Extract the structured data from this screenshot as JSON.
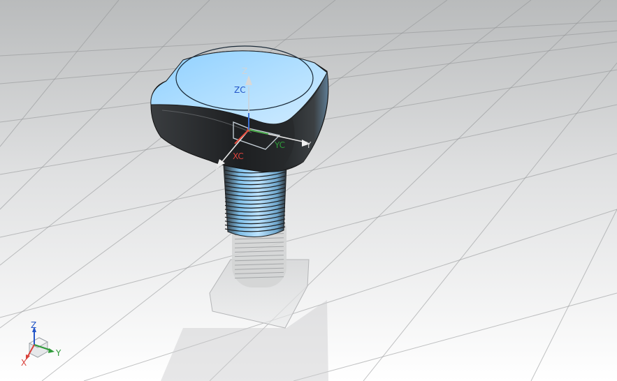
{
  "viewport": {
    "background_top": "#bdbfc0",
    "background_bottom": "#ffffff",
    "grid_color": "#8f9193"
  },
  "model": {
    "name": "bolt",
    "surface_light": "#a7dcff",
    "surface_dark": "#222427"
  },
  "wcs": {
    "z_label": "Z",
    "zc_label": "ZC",
    "xc_label": "XC",
    "yc_label": "YC",
    "x_label": "X",
    "y_label": "Y",
    "colors": {
      "x": "#d9423c",
      "y": "#2f9a3a",
      "z": "#2456c8"
    }
  },
  "triad": {
    "x_label": "X",
    "y_label": "Y",
    "z_label": "Z"
  }
}
